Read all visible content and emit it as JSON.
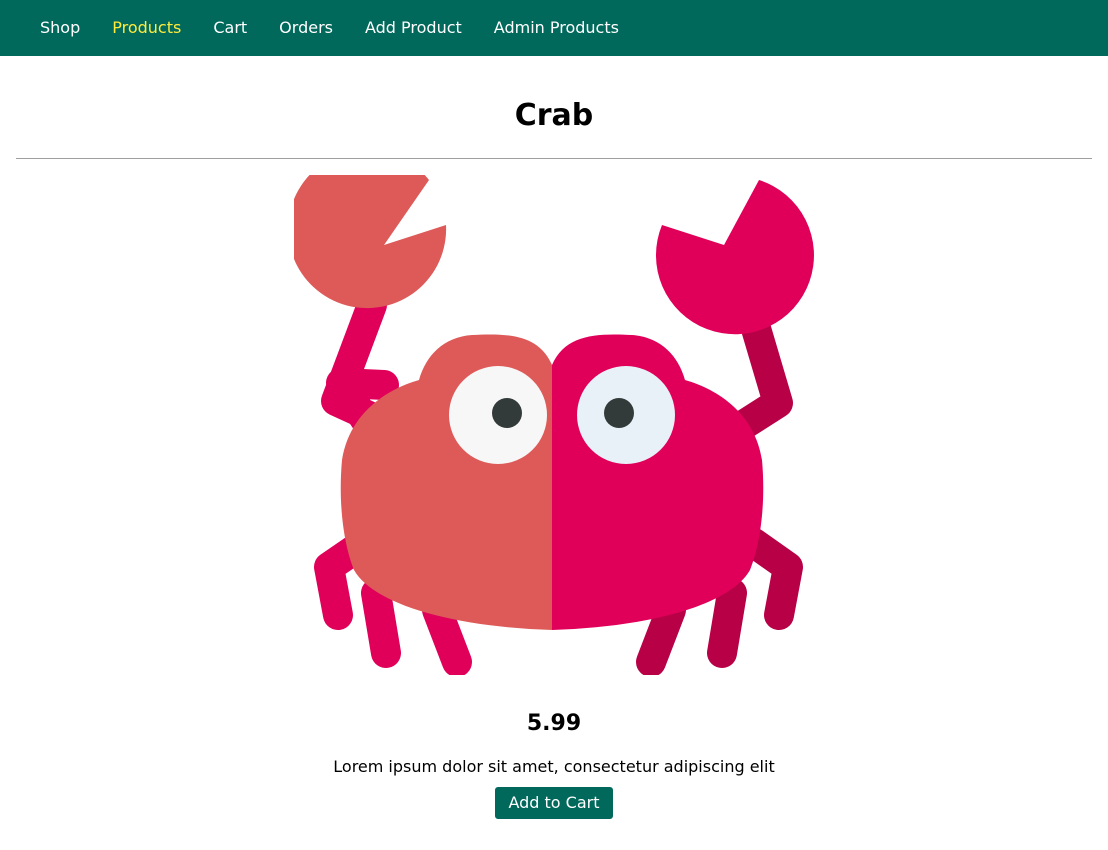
{
  "nav": {
    "items": [
      {
        "label": "Shop",
        "active": false
      },
      {
        "label": "Products",
        "active": true
      },
      {
        "label": "Cart",
        "active": false
      },
      {
        "label": "Orders",
        "active": false
      },
      {
        "label": "Add Product",
        "active": false
      },
      {
        "label": "Admin Products",
        "active": false
      }
    ],
    "active_color": "#ffeb3b",
    "background": "#00695c"
  },
  "product": {
    "title": "Crab",
    "image_icon": "crab-illustration",
    "price": "5.99",
    "description": "Lorem ipsum dolor sit amet, consectetur adipiscing elit",
    "add_to_cart_label": "Add to Cart"
  },
  "colors": {
    "accent": "#00695c",
    "crab_left": "#dd5a58",
    "crab_right": "#e0005a",
    "crab_right_leg": "#b80046"
  }
}
